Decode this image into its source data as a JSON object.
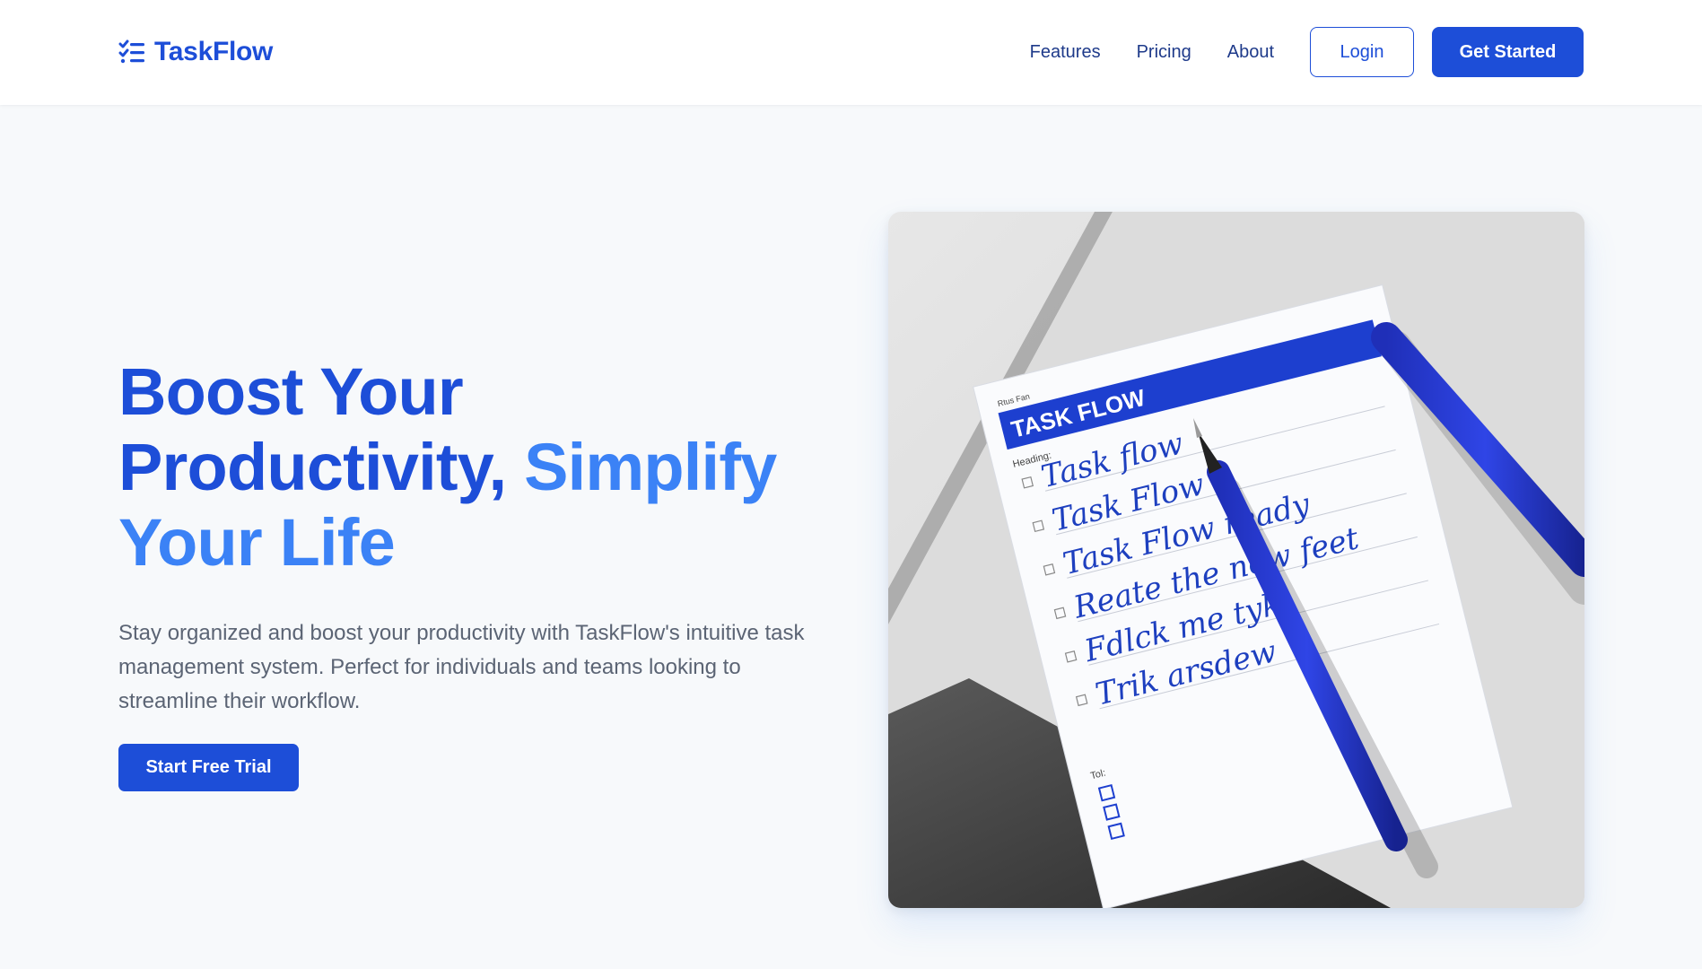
{
  "brand": {
    "name": "TaskFlow",
    "logo_icon": "checklist-icon",
    "color": "#1d4ed8"
  },
  "nav": {
    "links": [
      "Features",
      "Pricing",
      "About"
    ],
    "login_label": "Login",
    "get_started_label": "Get Started"
  },
  "hero": {
    "headline_part1": "Boost Your",
    "headline_part2": "Productivity,",
    "headline_accent": "Simplify",
    "headline_part3": "Your Life",
    "description": "Stay organized and boost your productivity with TaskFlow's intuitive task management system. Perfect for individuals and teams looking to streamline their workflow.",
    "cta_label": "Start Free Trial"
  },
  "image": {
    "banner_text": "TASK FLOW",
    "small_label": "Rtus Fan",
    "heading_label": "Heading:",
    "to_label": "Tol:",
    "handwritten_lines": [
      "Task flow",
      "Task Flow",
      "Task Flow ready",
      "Reate the new feet",
      "Fdlck me tyk",
      "Trik arsdew"
    ]
  },
  "colors": {
    "primary": "#1d4ed8",
    "accent": "#3b82f6",
    "background": "#f7f9fb",
    "text_muted": "#5b6474"
  }
}
